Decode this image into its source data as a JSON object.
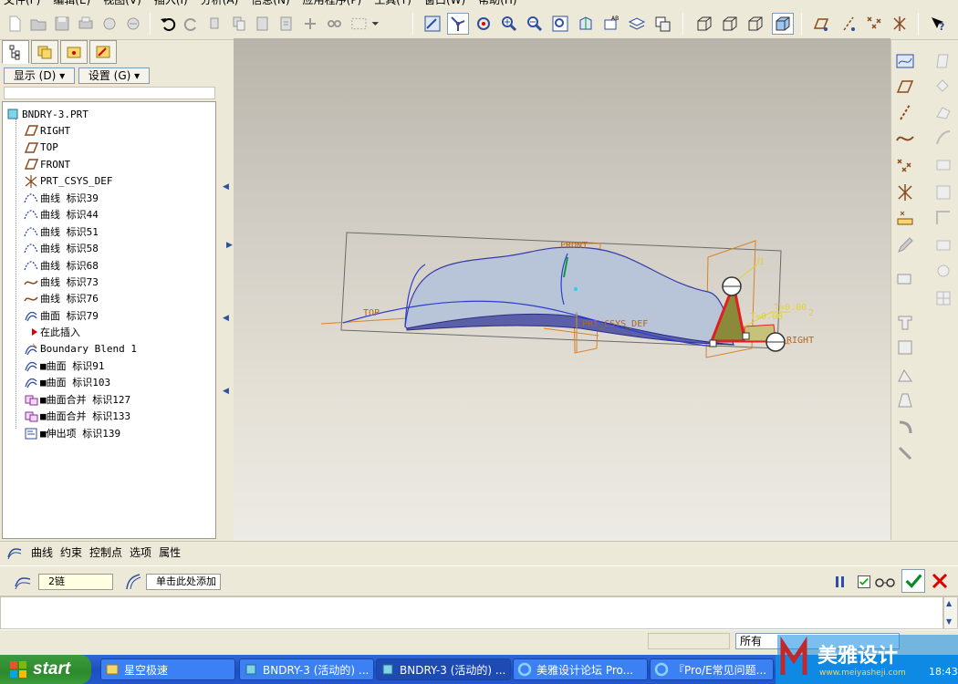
{
  "menu": [
    "文件(F)",
    "编辑(E)",
    "视图(V)",
    "插入(I)",
    "分析(A)",
    "信息(N)",
    "应用程序(P)",
    "工具(T)",
    "窗口(W)",
    "帮助(H)"
  ],
  "leftpanel": {
    "show_label": "显示 (D) ▾",
    "settings_label": "设置 (G) ▾"
  },
  "tree": [
    {
      "label": "BNDRY-3.PRT",
      "icon": "part-icon",
      "indent": 0
    },
    {
      "label": "RIGHT",
      "icon": "datum-plane-icon",
      "indent": 1
    },
    {
      "label": "TOP",
      "icon": "datum-plane-icon",
      "indent": 1
    },
    {
      "label": "FRONT",
      "icon": "datum-plane-icon",
      "indent": 1
    },
    {
      "label": "PRT_CSYS_DEF",
      "icon": "csys-icon",
      "indent": 1
    },
    {
      "label": "曲线 标识39",
      "icon": "curve-through-points-icon",
      "indent": 1
    },
    {
      "label": "曲线 标识44",
      "icon": "curve-through-points-icon",
      "indent": 1
    },
    {
      "label": "曲线 标识51",
      "icon": "curve-through-points-icon",
      "indent": 1
    },
    {
      "label": "曲线 标识58",
      "icon": "curve-through-points-icon",
      "indent": 1
    },
    {
      "label": "曲线 标识68",
      "icon": "curve-through-points-icon",
      "indent": 1
    },
    {
      "label": "曲线 标识73",
      "icon": "sketched-curve-icon",
      "indent": 1
    },
    {
      "label": "曲线 标识76",
      "icon": "sketched-curve-icon",
      "indent": 1
    },
    {
      "label": "曲面 标识79",
      "icon": "surface-icon",
      "indent": 1
    },
    {
      "label": "在此插入",
      "icon": "insert-here-arrow-icon",
      "indent": 1
    },
    {
      "label": "Boundary Blend 1",
      "icon": "boundary-blend-icon",
      "indent": 1
    },
    {
      "label": "■曲面 标识91",
      "icon": "surface-icon",
      "indent": 1
    },
    {
      "label": "■曲面 标识103",
      "icon": "surface-icon",
      "indent": 1
    },
    {
      "label": "■曲面合并 标识127",
      "icon": "merge-icon",
      "indent": 1
    },
    {
      "label": "■曲面合并 标识133",
      "icon": "merge-icon",
      "indent": 1
    },
    {
      "label": "■伸出项 标识139",
      "icon": "protrusion-icon",
      "indent": 1
    }
  ],
  "viewport": {
    "labels": {
      "front": "FRONT",
      "top": "TOP",
      "csys": "PRT_CSYS_DEF",
      "right": "RIGHT",
      "dim1": "1",
      "dim2": "T=0.00",
      "dim3": "2",
      "dim4": "T=0.00"
    }
  },
  "dashboard": {
    "tabs": [
      "曲线",
      "约束",
      "控制点",
      "选项",
      "属性"
    ],
    "chain_field": "2链",
    "click_field": "单击此处添加"
  },
  "status": {
    "filter": "所有"
  },
  "taskbar": {
    "start": "start",
    "tasks": [
      {
        "label": "星空极速",
        "icon": "network-icon"
      },
      {
        "label": "BNDRY-3 (活动的) ...",
        "icon": "proe-icon"
      },
      {
        "label": "BNDRY-3 (活动的) ...",
        "icon": "proe-icon"
      },
      {
        "label": "美雅设计论坛 Pro...",
        "icon": "ie-icon"
      },
      {
        "label": "『Pro/E常见问题...",
        "icon": "ie-icon"
      }
    ],
    "watermark": "美雅设计",
    "watermark_url": "www.meiyasheji.com",
    "clock": "18:43"
  },
  "colors": {
    "accent": "#2d4ea1",
    "orange": "#d9822b",
    "surface": "#b8c4d8"
  }
}
